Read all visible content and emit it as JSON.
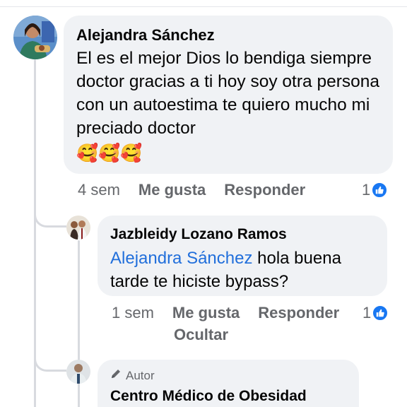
{
  "comments": [
    {
      "author": "Alejandra Sánchez",
      "text": "El es el mejor Dios lo bendiga siempre doctor gracias a ti hoy soy otra persona con un autoestima te quiero mucho mi preciado doctor",
      "emojis": "🥰🥰🥰",
      "time": "4 sem",
      "like_label": "Me gusta",
      "reply_label": "Responder",
      "reaction_count": "1"
    },
    {
      "author": "Jazbleidy Lozano Ramos",
      "mention": "Alejandra Sánchez",
      "text": " hola buena tarde te hiciste bypass?",
      "time": "1 sem",
      "like_label": "Me gusta",
      "reply_label": "Responder",
      "hide_label": "Ocultar",
      "reaction_count": "1"
    },
    {
      "author_badge": "Autor",
      "author": "Centro Médico de Obesidad"
    }
  ],
  "icons": {
    "like": "like-icon",
    "author": "pencil-icon"
  },
  "colors": {
    "bubble": "#f0f2f5",
    "mention": "#216fdb",
    "like_blue": "#1877f2",
    "meta": "#65676b"
  }
}
